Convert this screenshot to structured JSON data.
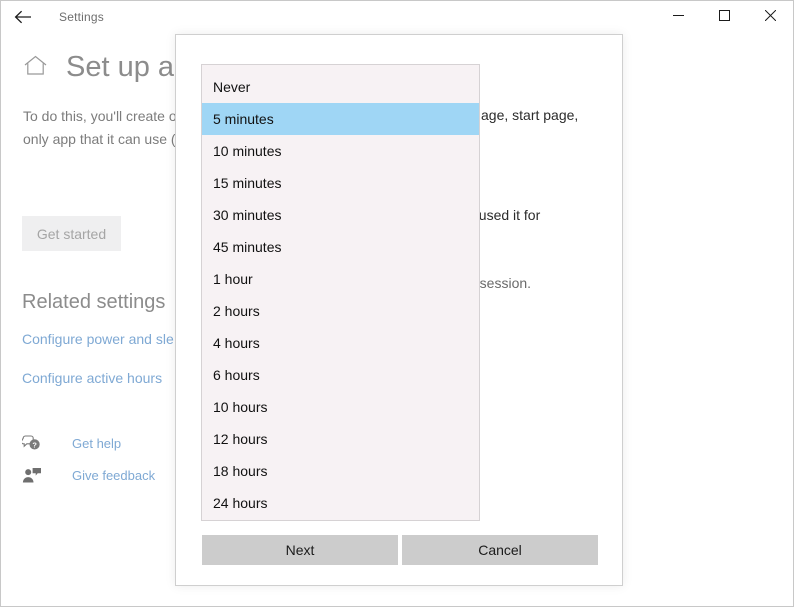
{
  "titlebar": {
    "back_icon": "back-arrow-icon",
    "title": "Settings",
    "minimize": "─",
    "maximize": "☐",
    "close": "✕"
  },
  "page": {
    "home_icon": "home-icon",
    "heading": "Set up a k",
    "body_line_1": "To do this, you'll create o",
    "body_line_2": "only app that it can use (",
    "get_started_label": "Get started",
    "related_heading": "Related settings",
    "links": [
      {
        "label": "Configure power and sle"
      },
      {
        "label": "Configure active hours"
      }
    ],
    "help_rows": [
      {
        "icon": "question-bubble-icon",
        "label": "Get help"
      },
      {
        "icon": "feedback-person-icon",
        "label": "Give feedback"
      }
    ]
  },
  "dialog": {
    "occluded_text": [
      "age, start page,",
      "t used it for",
      "g session."
    ],
    "buttons": {
      "next_label": "Next",
      "cancel_label": "Cancel"
    }
  },
  "dropdown": {
    "selected_value": "5 minutes",
    "highlight_color": "#9fd6f5",
    "background_color": "#f7f2f4",
    "options": [
      {
        "label": "Never"
      },
      {
        "label": "5 minutes"
      },
      {
        "label": "10 minutes"
      },
      {
        "label": "15 minutes"
      },
      {
        "label": "30 minutes"
      },
      {
        "label": "45 minutes"
      },
      {
        "label": "1 hour"
      },
      {
        "label": "2 hours"
      },
      {
        "label": "4 hours"
      },
      {
        "label": "6 hours"
      },
      {
        "label": "10 hours"
      },
      {
        "label": "12 hours"
      },
      {
        "label": "18 hours"
      },
      {
        "label": "24 hours"
      }
    ]
  }
}
